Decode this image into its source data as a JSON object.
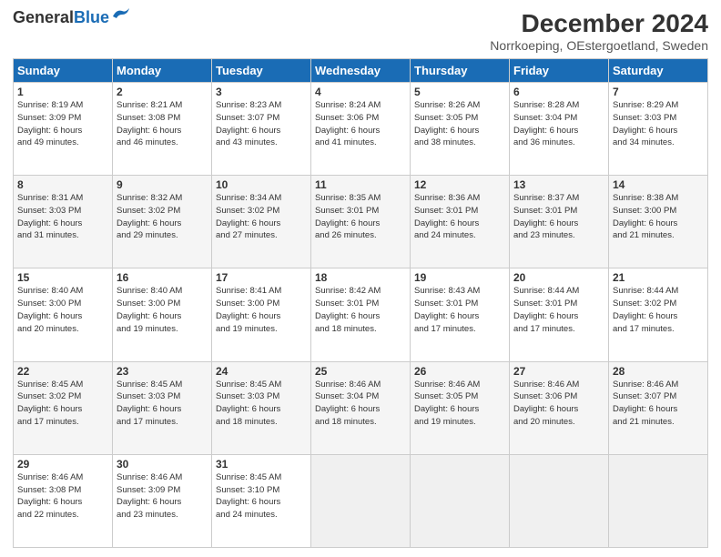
{
  "header": {
    "logo_line1": "General",
    "logo_line2": "Blue",
    "main_title": "December 2024",
    "subtitle": "Norrkoeping, OEstergoetland, Sweden"
  },
  "columns": [
    "Sunday",
    "Monday",
    "Tuesday",
    "Wednesday",
    "Thursday",
    "Friday",
    "Saturday"
  ],
  "weeks": [
    [
      {
        "day": "1",
        "info": "Sunrise: 8:19 AM\nSunset: 3:09 PM\nDaylight: 6 hours\nand 49 minutes."
      },
      {
        "day": "2",
        "info": "Sunrise: 8:21 AM\nSunset: 3:08 PM\nDaylight: 6 hours\nand 46 minutes."
      },
      {
        "day": "3",
        "info": "Sunrise: 8:23 AM\nSunset: 3:07 PM\nDaylight: 6 hours\nand 43 minutes."
      },
      {
        "day": "4",
        "info": "Sunrise: 8:24 AM\nSunset: 3:06 PM\nDaylight: 6 hours\nand 41 minutes."
      },
      {
        "day": "5",
        "info": "Sunrise: 8:26 AM\nSunset: 3:05 PM\nDaylight: 6 hours\nand 38 minutes."
      },
      {
        "day": "6",
        "info": "Sunrise: 8:28 AM\nSunset: 3:04 PM\nDaylight: 6 hours\nand 36 minutes."
      },
      {
        "day": "7",
        "info": "Sunrise: 8:29 AM\nSunset: 3:03 PM\nDaylight: 6 hours\nand 34 minutes."
      }
    ],
    [
      {
        "day": "8",
        "info": "Sunrise: 8:31 AM\nSunset: 3:03 PM\nDaylight: 6 hours\nand 31 minutes."
      },
      {
        "day": "9",
        "info": "Sunrise: 8:32 AM\nSunset: 3:02 PM\nDaylight: 6 hours\nand 29 minutes."
      },
      {
        "day": "10",
        "info": "Sunrise: 8:34 AM\nSunset: 3:02 PM\nDaylight: 6 hours\nand 27 minutes."
      },
      {
        "day": "11",
        "info": "Sunrise: 8:35 AM\nSunset: 3:01 PM\nDaylight: 6 hours\nand 26 minutes."
      },
      {
        "day": "12",
        "info": "Sunrise: 8:36 AM\nSunset: 3:01 PM\nDaylight: 6 hours\nand 24 minutes."
      },
      {
        "day": "13",
        "info": "Sunrise: 8:37 AM\nSunset: 3:01 PM\nDaylight: 6 hours\nand 23 minutes."
      },
      {
        "day": "14",
        "info": "Sunrise: 8:38 AM\nSunset: 3:00 PM\nDaylight: 6 hours\nand 21 minutes."
      }
    ],
    [
      {
        "day": "15",
        "info": "Sunrise: 8:40 AM\nSunset: 3:00 PM\nDaylight: 6 hours\nand 20 minutes."
      },
      {
        "day": "16",
        "info": "Sunrise: 8:40 AM\nSunset: 3:00 PM\nDaylight: 6 hours\nand 19 minutes."
      },
      {
        "day": "17",
        "info": "Sunrise: 8:41 AM\nSunset: 3:00 PM\nDaylight: 6 hours\nand 19 minutes."
      },
      {
        "day": "18",
        "info": "Sunrise: 8:42 AM\nSunset: 3:01 PM\nDaylight: 6 hours\nand 18 minutes."
      },
      {
        "day": "19",
        "info": "Sunrise: 8:43 AM\nSunset: 3:01 PM\nDaylight: 6 hours\nand 17 minutes."
      },
      {
        "day": "20",
        "info": "Sunrise: 8:44 AM\nSunset: 3:01 PM\nDaylight: 6 hours\nand 17 minutes."
      },
      {
        "day": "21",
        "info": "Sunrise: 8:44 AM\nSunset: 3:02 PM\nDaylight: 6 hours\nand 17 minutes."
      }
    ],
    [
      {
        "day": "22",
        "info": "Sunrise: 8:45 AM\nSunset: 3:02 PM\nDaylight: 6 hours\nand 17 minutes."
      },
      {
        "day": "23",
        "info": "Sunrise: 8:45 AM\nSunset: 3:03 PM\nDaylight: 6 hours\nand 17 minutes."
      },
      {
        "day": "24",
        "info": "Sunrise: 8:45 AM\nSunset: 3:03 PM\nDaylight: 6 hours\nand 18 minutes."
      },
      {
        "day": "25",
        "info": "Sunrise: 8:46 AM\nSunset: 3:04 PM\nDaylight: 6 hours\nand 18 minutes."
      },
      {
        "day": "26",
        "info": "Sunrise: 8:46 AM\nSunset: 3:05 PM\nDaylight: 6 hours\nand 19 minutes."
      },
      {
        "day": "27",
        "info": "Sunrise: 8:46 AM\nSunset: 3:06 PM\nDaylight: 6 hours\nand 20 minutes."
      },
      {
        "day": "28",
        "info": "Sunrise: 8:46 AM\nSunset: 3:07 PM\nDaylight: 6 hours\nand 21 minutes."
      }
    ],
    [
      {
        "day": "29",
        "info": "Sunrise: 8:46 AM\nSunset: 3:08 PM\nDaylight: 6 hours\nand 22 minutes."
      },
      {
        "day": "30",
        "info": "Sunrise: 8:46 AM\nSunset: 3:09 PM\nDaylight: 6 hours\nand 23 minutes."
      },
      {
        "day": "31",
        "info": "Sunrise: 8:45 AM\nSunset: 3:10 PM\nDaylight: 6 hours\nand 24 minutes."
      },
      {
        "day": "",
        "info": ""
      },
      {
        "day": "",
        "info": ""
      },
      {
        "day": "",
        "info": ""
      },
      {
        "day": "",
        "info": ""
      }
    ]
  ]
}
